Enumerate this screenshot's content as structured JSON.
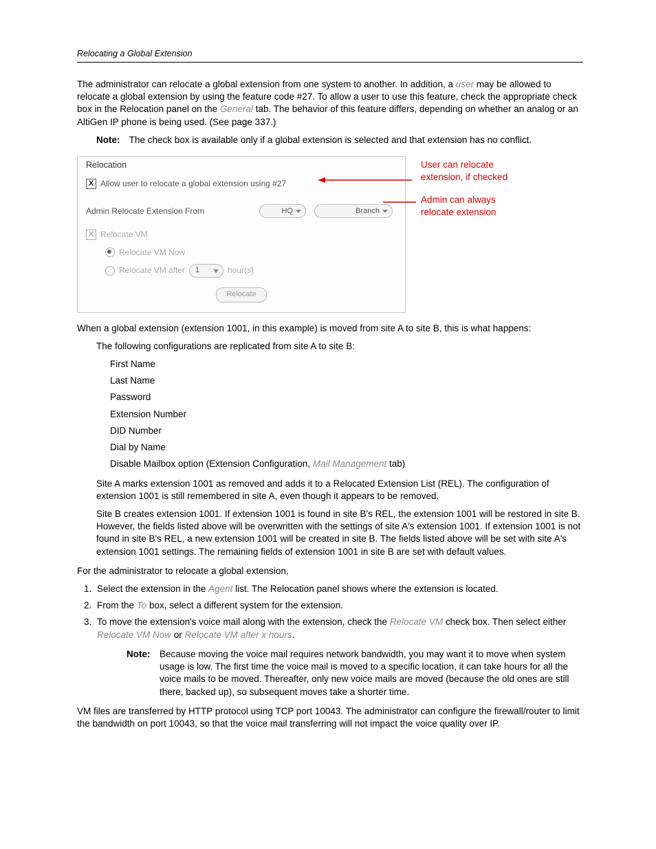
{
  "header": {
    "section": "Relocating a Global Extension"
  },
  "paras": {
    "p1a": "The administrator can relocate a global extension from one system to another. In addition, a ",
    "p1b": "user",
    "p1c": " may be allowed to relocate a global extension by using the feature code #27. To allow a user to use this feature, check the appropriate check box in the Relocation panel on the ",
    "p1d": "General",
    "p1e": " tab. The behavior of this feature differs, depending on whether an analog or an AltiGen IP phone is being used. (See page 337.)",
    "noteLabel": "Note:",
    "note1": "The check box is available only if a global extension is selected and that extension has no conflict.",
    "p2": "When a global extension (extension 1001, in this example) is moved from site A to site B, this is what happens:",
    "p3": "The following configurations are replicated from site A to site B:",
    "fields": [
      "First Name",
      "Last Name",
      "Password",
      "Extension Number",
      "DID Number",
      "Dial by Name"
    ],
    "fieldLast_a": "Disable Mailbox option (Extension Configuration, ",
    "fieldLast_b": "Mail Management",
    "fieldLast_c": " tab)",
    "p4": "Site A marks extension 1001 as removed and adds it to a Relocated Extension List (REL). The configuration of extension 1001 is still remembered in site A, even though it appears to be removed.",
    "p5": "Site B creates extension 1001. If extension 1001 is found in site B's REL, the extension 1001 will be restored in site B. However, the fields listed above will be overwritten with the settings of site A's extension 1001. If extension 1001 is not found in site B's REL, a new extension 1001 will be created in site B. The fields listed above will be set with site A's extension 1001 settings. The remaining fields of extension 1001 in site B are set with default values.",
    "p6": "For the administrator to relocate a global extension,",
    "s1a": "Select the extension in the ",
    "s1b": "Agent",
    "s1c": " list. The Relocation panel shows where the extension is located.",
    "s2a": "From the ",
    "s2b": "To",
    "s2c": " box, select a different system for the extension.",
    "s3a": "To move the extension's voice mail along with the extension, check the ",
    "s3b": "Relocate VM",
    "s3c": " check box. Then select either ",
    "s3d": "Relocate VM Now",
    "s3e": " or ",
    "s3f": "Relocate VM after x hours",
    "s3g": ".",
    "note2": "Because moving the voice mail requires network bandwidth, you may want it to move when system usage is low. The first time the voice mail is moved to a specific location, it can take hours for all the voice mails to be moved. Thereafter, only new voice mails are moved (because the old ones are still there, backed up), so subsequent moves take a shorter time.",
    "p7": "VM files are transferred by HTTP protocol using TCP port 10043. The administrator can configure the firewall/router to limit the bandwidth on port 10043, so that the voice mail transferring will not impact the voice quality over IP."
  },
  "panel": {
    "title": "Relocation",
    "allowLabel": "Allow user to relocate a global extension using #27",
    "adminFromLabel": "Admin Relocate Extension From",
    "fromValue": "HQ",
    "toValue": "Branch",
    "relocateVM": "Relocate VM",
    "vmNow": "Relocate VM Now",
    "vmAfter": "Relocate VM after",
    "hourVal": "1",
    "hours": "hour(s)",
    "relocateBtn": "Relocate"
  },
  "annotations": {
    "a1": "User can relocate extension, if checked",
    "a2": "Admin can always relocate extension"
  }
}
